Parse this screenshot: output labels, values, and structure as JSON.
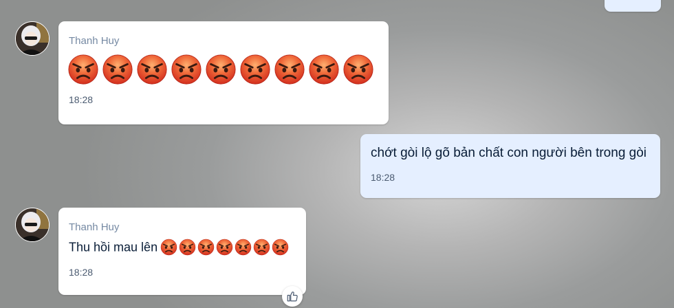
{
  "messages": [
    {
      "sender": "Thanh Huy",
      "time": "18:28",
      "emoji_count": 9,
      "emoji": "pouting-face"
    },
    {
      "text": "chớt gòi lộ gõ bản chất con người bên trong gòi",
      "time": "18:28"
    },
    {
      "sender": "Thanh Huy",
      "text": "Thu hồi mau lên",
      "time": "18:28",
      "emoji_count": 7,
      "emoji": "pouting-face"
    }
  ],
  "icons": {
    "reaction": "thumbs-up-icon"
  },
  "colors": {
    "incoming_bubble": "#ffffff",
    "outgoing_bubble": "#e5efff",
    "sender_name": "#7589a3",
    "text": "#081c36"
  }
}
